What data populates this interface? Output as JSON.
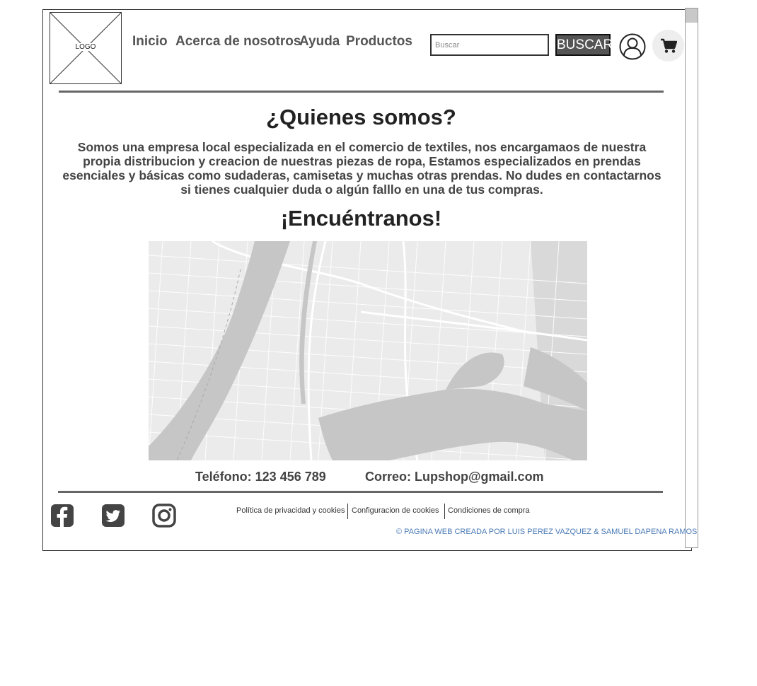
{
  "header": {
    "logo_text": "LOGO",
    "nav": [
      "Inicio",
      "Acerca de nosotros",
      "Ayuda",
      "Productos"
    ],
    "search": {
      "placeholder": "Buscar",
      "button_label": "BUSCAR"
    },
    "icons": [
      "user-icon",
      "shopping-cart-icon"
    ]
  },
  "about": {
    "title": "¿Quienes somos?",
    "text": "Somos una empresa local especializada en el comercio de textiles, nos encargamaos de nuestra propia distribucion y creacion de nuestras piezas de ropa, Estamos especializados en prendas esenciales y básicas como sudaderas, camisetas y muchas otras prendas. No dudes en contactarnos si tienes cualquier duda o algún falllo en una de tus compras."
  },
  "find_us": {
    "title": "¡Encuéntranos!",
    "map": "city-map-image"
  },
  "contact": {
    "phone": "Teléfono:  123 456 789",
    "email": "Correo:  Lupshop@gmail.com"
  },
  "footer": {
    "social_icons": [
      "facebook-icon",
      "twitter-icon",
      "instagram-icon"
    ],
    "links": [
      "Política de privacidad y cookies",
      "Configuracion de cookies",
      "Condiciones de compra"
    ],
    "credit": "© PAGINA WEB CREADA POR LUIS PEREZ VAZQUEZ & SAMUEL DAPENA RAMOS"
  },
  "colors": {
    "border": "#333333",
    "divider": "#666666",
    "button_bg": "#555555",
    "credit_text": "#4a7ab5",
    "map_bg": "#ebebeb",
    "map_water": "#c6c6c6"
  }
}
